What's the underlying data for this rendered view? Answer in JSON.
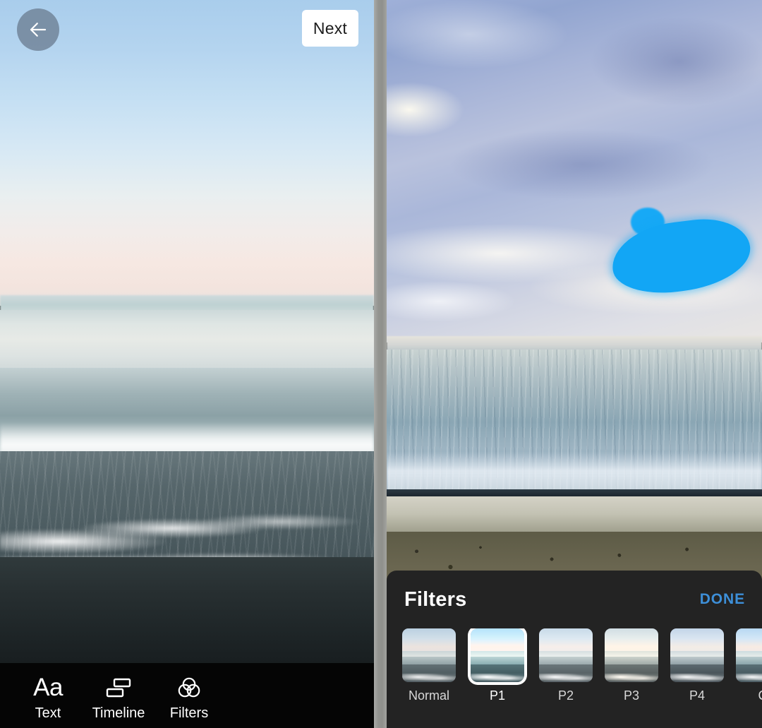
{
  "left_screen": {
    "topbar": {
      "back_button": {
        "icon": "arrow-left-icon",
        "label": "Back"
      },
      "next_button": {
        "label": "Next"
      }
    },
    "media": {
      "description": "Ocean waves rolling onto dark sand at dusk with pastel sky"
    },
    "toolbar": {
      "items": [
        {
          "icon": "text-aa-icon",
          "glyph": "Aa",
          "label": "Text"
        },
        {
          "icon": "timeline-icon",
          "glyph": "",
          "label": "Timeline"
        },
        {
          "icon": "filters-icon",
          "glyph": "",
          "label": "Filters"
        }
      ]
    }
  },
  "right_screen": {
    "media": {
      "description": "Beach with pebbled sand, calm sea and dramatic cloudy sky with a bright blue opening"
    },
    "filters_sheet": {
      "title": "Filters",
      "done_label": "DONE",
      "selected": "P1",
      "items": [
        {
          "label": "Normal",
          "selected": false
        },
        {
          "label": "P1",
          "selected": true
        },
        {
          "label": "P2",
          "selected": false
        },
        {
          "label": "P3",
          "selected": false
        },
        {
          "label": "P4",
          "selected": false
        },
        {
          "label": "C",
          "selected": false
        }
      ]
    }
  },
  "colors": {
    "accent_done": "#3d8fd8",
    "sheet_background": "#232323",
    "toolbar_background": "#050505",
    "next_button_background": "#ffffff",
    "divider": "#93948f"
  }
}
